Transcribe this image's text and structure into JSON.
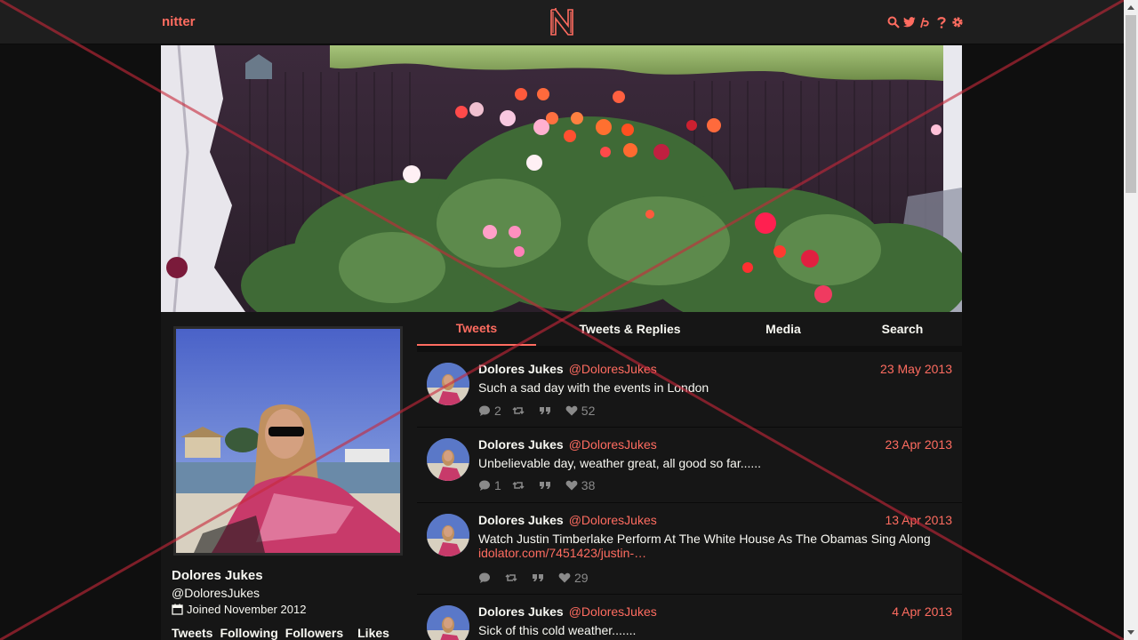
{
  "nav": {
    "brand": "nitter",
    "icons": [
      "search-icon",
      "twitter-bird-icon",
      "rss-icon",
      "help-icon",
      "gear-icon"
    ]
  },
  "profile": {
    "name": "Dolores Jukes",
    "handle": "@DoloresJukes",
    "joined": "Joined November 2012",
    "stats": [
      "Tweets",
      "Following",
      "Followers",
      "Likes"
    ]
  },
  "tabs": [
    {
      "label": "Tweets",
      "active": true
    },
    {
      "label": "Tweets & Replies",
      "active": false
    },
    {
      "label": "Media",
      "active": false
    },
    {
      "label": "Search",
      "active": false
    }
  ],
  "tweets": [
    {
      "name": "Dolores Jukes",
      "handle": "@DoloresJukes",
      "date": "23 May 2013",
      "text": "Such a sad day with the events in London",
      "link": "",
      "replies": "2",
      "retweets": "",
      "quotes": "",
      "likes": "52"
    },
    {
      "name": "Dolores Jukes",
      "handle": "@DoloresJukes",
      "date": "23 Apr 2013",
      "text": "Unbelievable day, weather great, all good so far......",
      "link": "",
      "replies": "1",
      "retweets": "",
      "quotes": "",
      "likes": "38"
    },
    {
      "name": "Dolores Jukes",
      "handle": "@DoloresJukes",
      "date": "13 Apr 2013",
      "text": "Watch Justin Timberlake Perform At The White House As The Obamas Sing Along",
      "link": "idolator.com/7451423/justin-…",
      "replies": "",
      "retweets": "",
      "quotes": "",
      "likes": "29"
    },
    {
      "name": "Dolores Jukes",
      "handle": "@DoloresJukes",
      "date": "4 Apr 2013",
      "text": "Sick of this cold weather.......",
      "link": "",
      "replies": "",
      "retweets": "",
      "quotes": "",
      "likes": ""
    }
  ],
  "colors": {
    "accent": "#ff6c60",
    "background": "#0f0f0f",
    "panel": "#161616",
    "navbar": "#1e1e1e"
  }
}
